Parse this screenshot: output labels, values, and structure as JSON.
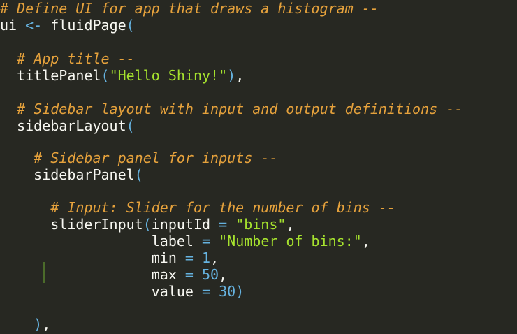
{
  "code": {
    "l1": {
      "comment": "# Define UI for app that draws a histogram --"
    },
    "l2": {
      "var": "ui",
      "assign": "<-",
      "fn": "fluidPage",
      "open": "("
    },
    "l3": {
      "comment": "# App title --"
    },
    "l4": {
      "fn": "titlePanel",
      "open": "(",
      "str": "\"Hello Shiny!\"",
      "close": ")",
      "comma": ","
    },
    "l5": {
      "comment": "# Sidebar layout with input and output definitions --"
    },
    "l6": {
      "fn": "sidebarLayout",
      "open": "("
    },
    "l7": {
      "comment": "# Sidebar panel for inputs --"
    },
    "l8": {
      "fn": "sidebarPanel",
      "open": "("
    },
    "l9": {
      "comment": "# Input: Slider for the number of bins --"
    },
    "l10": {
      "fn": "sliderInput",
      "open": "(",
      "arg": "inputId",
      "eq": "=",
      "str": "\"bins\"",
      "comma": ","
    },
    "l11": {
      "arg": "label",
      "eq": "=",
      "str": "\"Number of bins:\"",
      "comma": ","
    },
    "l12": {
      "arg": "min",
      "eq": "=",
      "num": "1",
      "comma": ","
    },
    "l13": {
      "arg": "max",
      "eq": "=",
      "num": "50",
      "comma": ","
    },
    "l14": {
      "arg": "value",
      "eq": "=",
      "num": "30",
      "close": ")"
    },
    "l15": {
      "close": ")",
      "comma": ","
    }
  }
}
